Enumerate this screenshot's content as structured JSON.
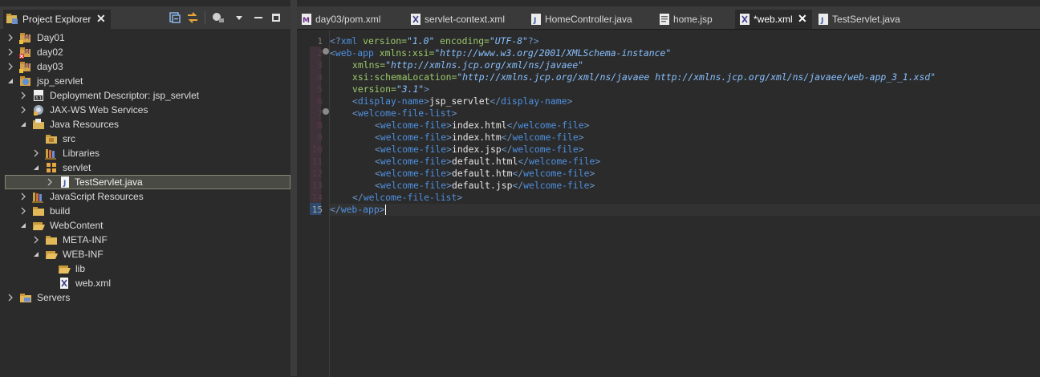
{
  "explorer": {
    "title": "Project Explorer",
    "close": "✕",
    "items": [
      {
        "label": "Day01"
      },
      {
        "label": "day02"
      },
      {
        "label": "day03"
      },
      {
        "label": "jsp_servlet"
      },
      {
        "label": "Deployment Descriptor: jsp_servlet"
      },
      {
        "label": "JAX-WS Web Services"
      },
      {
        "label": "Java Resources"
      },
      {
        "label": "src"
      },
      {
        "label": "Libraries"
      },
      {
        "label": "servlet"
      },
      {
        "label": "TestServlet.java"
      },
      {
        "label": "JavaScript Resources"
      },
      {
        "label": "build"
      },
      {
        "label": "WebContent"
      },
      {
        "label": "META-INF"
      },
      {
        "label": "WEB-INF"
      },
      {
        "label": "lib"
      },
      {
        "label": "web.xml"
      },
      {
        "label": "Servers"
      }
    ]
  },
  "editor": {
    "tabs": [
      {
        "label": "day03/pom.xml"
      },
      {
        "label": "servlet-context.xml"
      },
      {
        "label": "HomeController.java"
      },
      {
        "label": "home.jsp"
      },
      {
        "label": "*web.xml",
        "close": "✕"
      },
      {
        "label": "TestServlet.java"
      }
    ],
    "line_numbers": [
      "1",
      "2",
      "3",
      "4",
      "5",
      "6",
      "7",
      "8",
      "9",
      "10",
      "11",
      "12",
      "13",
      "14",
      "15"
    ],
    "code": {
      "l1": {
        "a": "<?",
        "b": "xml",
        "c": " version=",
        "d": "\"1.0\"",
        "e": " encoding=",
        "f": "\"UTF-8\"",
        "g": "?>"
      },
      "l2": {
        "a": "<",
        "b": "web-app",
        "c": " xmlns:xsi=",
        "d": "\"http://www.w3.org/2001/XMLSchema-instance\""
      },
      "l3": {
        "c": "xmlns=",
        "d": "\"http://xmlns.jcp.org/xml/ns/javaee\""
      },
      "l4": {
        "c": "xsi:schemaLocation=",
        "d": "\"http://xmlns.jcp.org/xml/ns/javaee http://xmlns.jcp.org/xml/ns/javaee/web-app_3_1.xsd\""
      },
      "l5": {
        "c": "version=",
        "d": "\"3.1\"",
        "e": ">"
      },
      "l6": {
        "a": "<",
        "b": "display-name",
        "c": ">",
        "t": "jsp_servlet",
        "d": "</",
        "e": "display-name",
        "f": ">"
      },
      "l7": {
        "a": "<",
        "b": "welcome-file-list",
        "c": ">"
      },
      "l8": {
        "a": "<",
        "b": "welcome-file",
        "c": ">",
        "t": "index.html",
        "d": "</",
        "e": "welcome-file",
        "f": ">"
      },
      "l9": {
        "a": "<",
        "b": "welcome-file",
        "c": ">",
        "t": "index.htm",
        "d": "</",
        "e": "welcome-file",
        "f": ">"
      },
      "l10": {
        "a": "<",
        "b": "welcome-file",
        "c": ">",
        "t": "index.jsp",
        "d": "</",
        "e": "welcome-file",
        "f": ">"
      },
      "l11": {
        "a": "<",
        "b": "welcome-file",
        "c": ">",
        "t": "default.html",
        "d": "</",
        "e": "welcome-file",
        "f": ">"
      },
      "l12": {
        "a": "<",
        "b": "welcome-file",
        "c": ">",
        "t": "default.htm",
        "d": "</",
        "e": "welcome-file",
        "f": ">"
      },
      "l13": {
        "a": "<",
        "b": "welcome-file",
        "c": ">",
        "t": "default.jsp",
        "d": "</",
        "e": "welcome-file",
        "f": ">"
      },
      "l14": {
        "a": "</",
        "b": "welcome-file-list",
        "c": ">"
      },
      "l15": {
        "a": "</",
        "b": "web-app",
        "c": ">"
      }
    }
  }
}
